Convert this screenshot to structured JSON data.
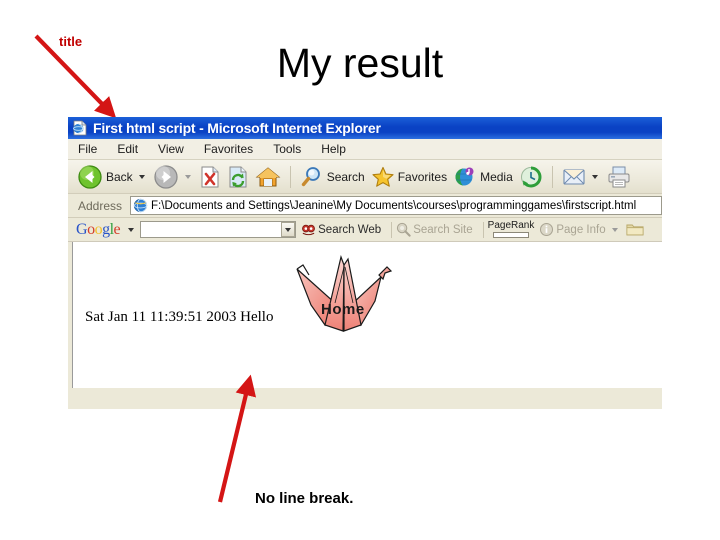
{
  "slide": {
    "title": "My result",
    "annotation_title": "title",
    "annotation_bottom": "No line break.",
    "annotation_color": "#C00000"
  },
  "browser": {
    "title_bar": {
      "text": "First html script - Microsoft Internet Explorer",
      "icon": "ie-document-icon",
      "background_color": "#0A42C4",
      "text_color": "#FFFFFF"
    },
    "menu": [
      {
        "label": "File"
      },
      {
        "label": "Edit"
      },
      {
        "label": "View"
      },
      {
        "label": "Favorites"
      },
      {
        "label": "Tools"
      },
      {
        "label": "Help"
      }
    ],
    "toolbar": [
      {
        "label": "Back",
        "icon": "back-arrow-icon",
        "has_caret": true
      },
      {
        "label": "",
        "icon": "forward-arrow-icon",
        "has_caret": true,
        "disabled": true
      },
      {
        "label": "",
        "icon": "stop-icon"
      },
      {
        "label": "",
        "icon": "refresh-icon"
      },
      {
        "label": "",
        "icon": "home-icon"
      },
      {
        "label": "Search",
        "icon": "search-magnifier-icon"
      },
      {
        "label": "Favorites",
        "icon": "favorites-star-icon"
      },
      {
        "label": "Media",
        "icon": "media-globe-icon"
      },
      {
        "label": "",
        "icon": "history-icon"
      },
      {
        "label": "",
        "icon": "mail-envelope-icon",
        "has_caret": true
      },
      {
        "label": "",
        "icon": "printer-icon"
      }
    ],
    "address": {
      "label": "Address",
      "icon": "ie-globe-icon",
      "value": "F:\\Documents and Settings\\Jeanine\\My Documents\\courses\\programminggames\\firstscript.html"
    },
    "google_toolbar": {
      "logo_letters": [
        "G",
        "o",
        "o",
        "g",
        "l",
        "e"
      ],
      "search_value": "",
      "search_placeholder": "",
      "items": [
        {
          "label": "Search Web",
          "icon": "google-search-web-icon",
          "disabled": false
        },
        {
          "label": "Search Site",
          "icon": "google-search-site-icon",
          "disabled": true
        },
        {
          "label": "PageRank",
          "icon": "pagerank-meter-icon",
          "disabled": false
        },
        {
          "label": "Page Info",
          "icon": "page-info-icon",
          "disabled": true,
          "has_caret": true
        },
        {
          "label": "",
          "icon": "folder-icon",
          "disabled": false
        }
      ]
    },
    "page": {
      "text": "Sat Jan 11 11:39:51 2003 Hello",
      "image_alt": "Home",
      "image_name": "origami-crane-home-image",
      "crane_color_light": "#F9C4BE",
      "crane_color_dark": "#F0857A"
    }
  }
}
